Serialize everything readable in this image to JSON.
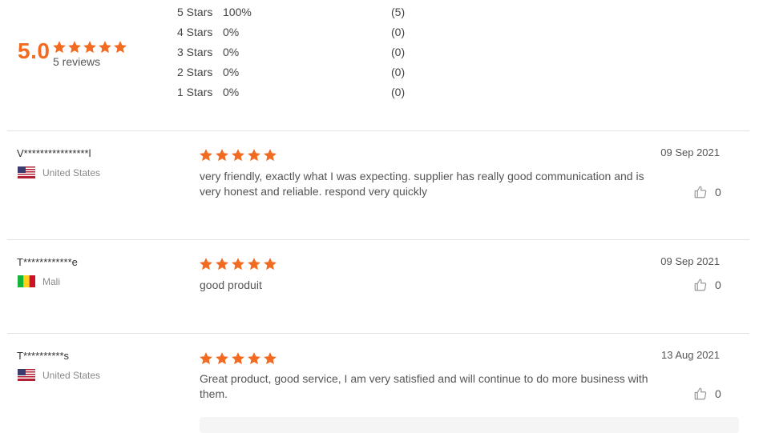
{
  "summary": {
    "score": "5.0",
    "stars_filled": 5,
    "reviews_label": "5 reviews"
  },
  "distribution": [
    {
      "label": "5 Stars",
      "percent": "100%",
      "count": "(5)"
    },
    {
      "label": "4 Stars",
      "percent": "0%",
      "count": "(0)"
    },
    {
      "label": "3 Stars",
      "percent": "0%",
      "count": "(0)"
    },
    {
      "label": "2 Stars",
      "percent": "0%",
      "count": "(0)"
    },
    {
      "label": "1 Stars",
      "percent": "0%",
      "count": "(0)"
    }
  ],
  "reviews": [
    {
      "name": "V****************l",
      "country": "United States",
      "flag": "us-flag",
      "rating": 5,
      "text": "very friendly, exactly what I was expecting. supplier has really good communication and is very honest and reliable. respond very quickly",
      "date": "09 Sep 2021",
      "helpful_count": "0"
    },
    {
      "name": "T************e",
      "country": "Mali",
      "flag": "mali-flag",
      "rating": 5,
      "text": "good produit",
      "date": "09 Sep 2021",
      "helpful_count": "0"
    },
    {
      "name": "T**********s",
      "country": "United States",
      "flag": "us-flag",
      "rating": 5,
      "text": "Great product, good service, I am very satisfied and will continue to do more business with them.",
      "date": "13 Aug 2021",
      "helpful_count": "0"
    }
  ],
  "colors": {
    "star": "#f26b21",
    "score": "#f26b21",
    "divider": "#e3e3e3"
  },
  "icons": {
    "star": "star-icon",
    "thumb": "thumbs-up-icon"
  }
}
